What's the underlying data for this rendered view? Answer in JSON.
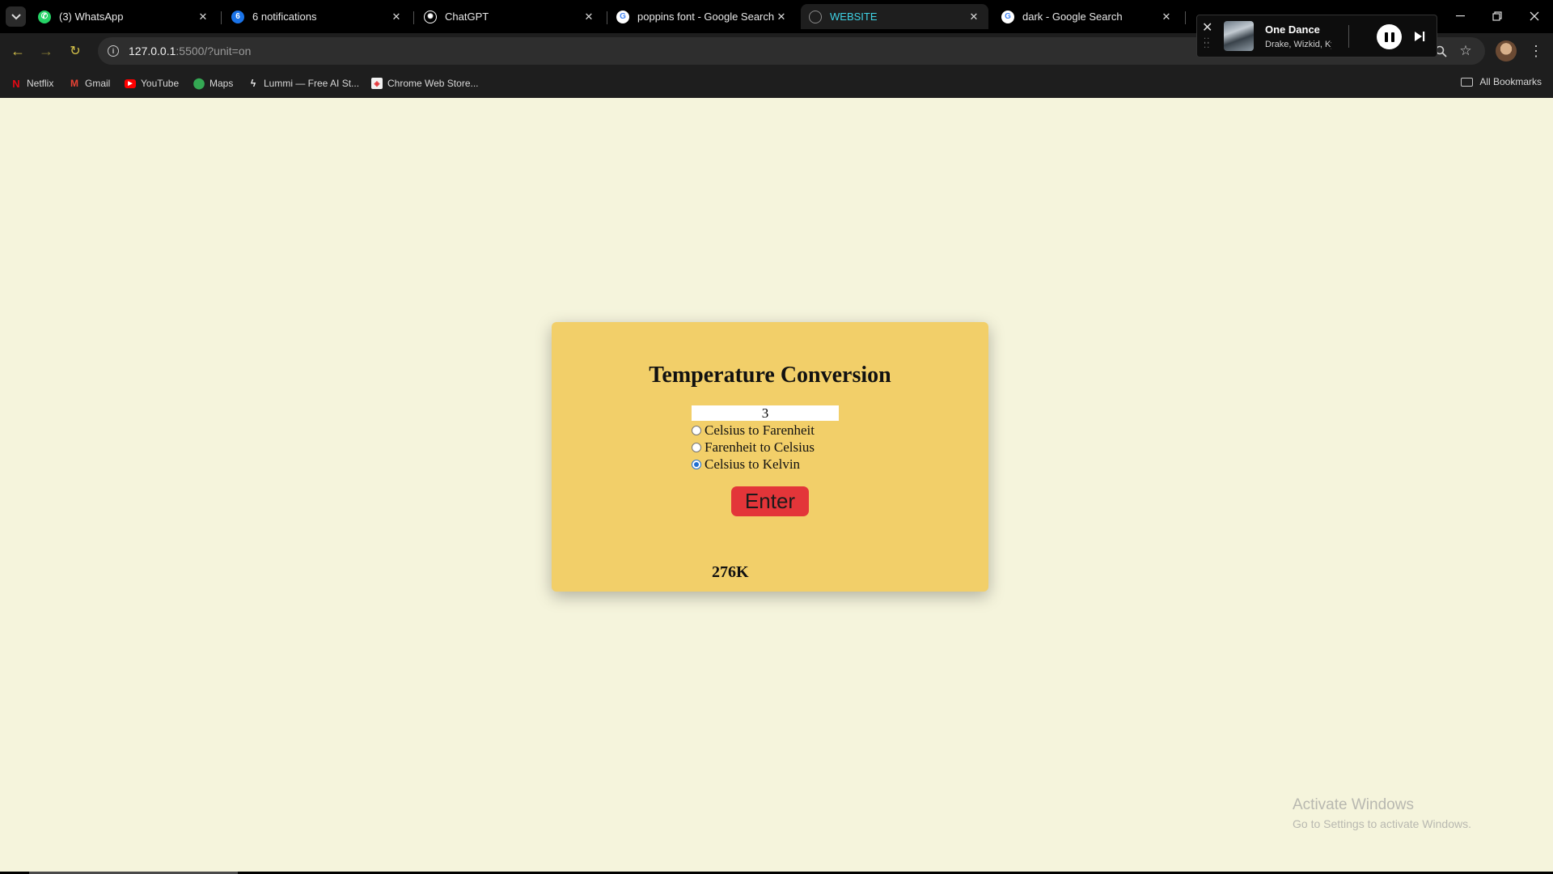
{
  "tabs": [
    {
      "label": "(3) WhatsApp",
      "icon": "whatsapp-icon",
      "color": "#25d366"
    },
    {
      "label": "6 notifications",
      "icon": "notifications-icon",
      "badge": "6",
      "color": "#1a73e8"
    },
    {
      "label": "ChatGPT",
      "icon": "chatgpt-icon",
      "color": "#ffffff"
    },
    {
      "label": "poppins font - Google Search",
      "icon": "google-icon",
      "color": "#ffffff"
    },
    {
      "label": "WEBSITE",
      "icon": "globe-icon",
      "color": "#888888",
      "active": true
    },
    {
      "label": "dark - Google Search",
      "icon": "google-icon",
      "color": "#ffffff"
    }
  ],
  "address": {
    "host": "127.0.0.1",
    "rest": ":5500/?unit=on"
  },
  "bookmarks": [
    {
      "label": "Netflix",
      "icon": "netflix-icon"
    },
    {
      "label": "Gmail",
      "icon": "gmail-icon"
    },
    {
      "label": "YouTube",
      "icon": "youtube-icon"
    },
    {
      "label": "Maps",
      "icon": "maps-icon"
    },
    {
      "label": "Lummi — Free AI St...",
      "icon": "lummi-icon"
    },
    {
      "label": "Chrome Web Store...",
      "icon": "chrome-web-store-icon"
    }
  ],
  "all_bookmarks": "All Bookmarks",
  "media": {
    "title": "One Dance",
    "artist": "Drake, Wizkid, Kyla"
  },
  "page": {
    "title": "Temperature Conversion",
    "input_value": "3",
    "options": [
      {
        "label": "Celsius to Farenheit",
        "checked": false
      },
      {
        "label": "Farenheit to Celsius",
        "checked": false
      },
      {
        "label": "Celsius to Kelvin",
        "checked": true
      }
    ],
    "button": "Enter",
    "result": "276K"
  },
  "colors": {
    "page_bg": "#f5f4dc",
    "card_bg": "#f2cf69",
    "button_bg": "#e33539",
    "radio_accent": "#1f6fd1"
  },
  "watermark": {
    "title": "Activate Windows",
    "subtitle": "Go to Settings to activate Windows."
  }
}
